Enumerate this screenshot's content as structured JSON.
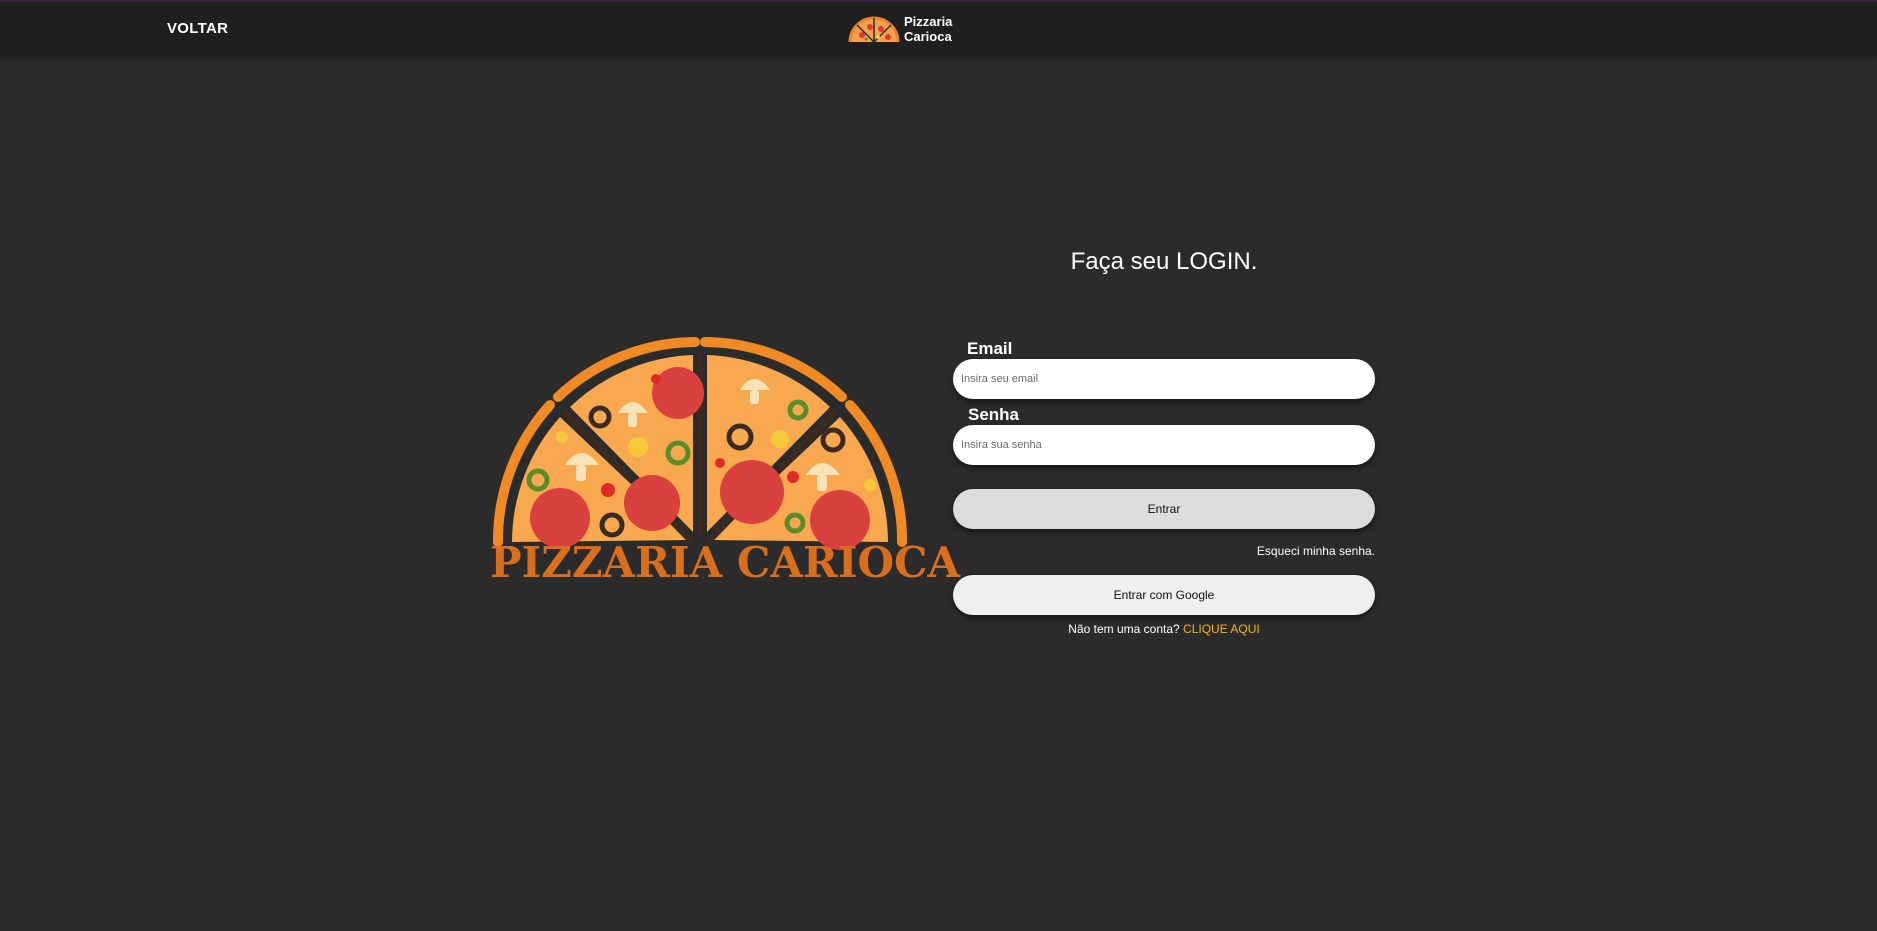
{
  "header": {
    "back_label": "VOLTAR",
    "brand_name_line1": "Pizzaria",
    "brand_name_line2": "Carioca"
  },
  "hero": {
    "wordmark": "PIZZARIA CARIOCA"
  },
  "login": {
    "title": "Faça seu LOGIN.",
    "email_label": "Email",
    "email_placeholder": "Insira seu email",
    "password_label": "Senha",
    "password_placeholder": "Insira sua senha",
    "submit_label": "Entrar",
    "forgot_label": "Esqueci minha senha.",
    "google_label": "Entrar com Google",
    "signup_prompt": "Não tem uma conta?",
    "signup_link": "CLIQUE AQUI"
  },
  "colors": {
    "background": "#2b2b2b",
    "header": "#1f1f1f",
    "brand_orange": "#d96e1c",
    "link_yellow": "#f2b21b"
  }
}
